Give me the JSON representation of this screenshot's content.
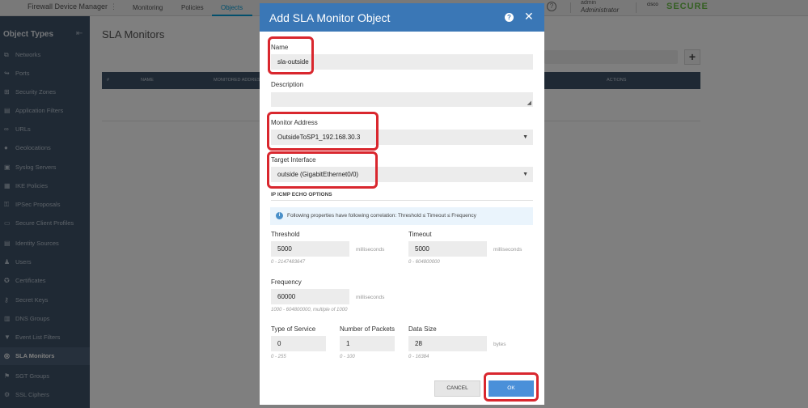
{
  "header": {
    "app_title": "Firewall Device Manager",
    "nav": [
      "Monitoring",
      "Policies",
      "Objects"
    ],
    "active_nav": "Objects",
    "user_name": "admin",
    "user_role": "Administrator",
    "brand_cisco": "cisco",
    "brand_secure": "SECURE"
  },
  "sidebar": {
    "title": "Object Types",
    "items": [
      {
        "label": "Networks",
        "icon": "network-icon"
      },
      {
        "label": "Ports",
        "icon": "ports-icon"
      },
      {
        "label": "Security Zones",
        "icon": "zones-icon"
      },
      {
        "label": "Application Filters",
        "icon": "filter-icon"
      },
      {
        "label": "URLs",
        "icon": "link-icon"
      },
      {
        "label": "Geolocations",
        "icon": "location-icon"
      },
      {
        "label": "Syslog Servers",
        "icon": "server-icon"
      },
      {
        "label": "IKE Policies",
        "icon": "lock-icon"
      },
      {
        "label": "IPSec Proposals",
        "icon": "proposal-icon"
      },
      {
        "label": "Secure Client Profiles",
        "icon": "profile-icon"
      },
      {
        "label": "Identity Sources",
        "icon": "identity-icon"
      },
      {
        "label": "Users",
        "icon": "user-icon"
      },
      {
        "label": "Certificates",
        "icon": "certificate-icon"
      },
      {
        "label": "Secret Keys",
        "icon": "key-icon"
      },
      {
        "label": "DNS Groups",
        "icon": "dns-icon"
      },
      {
        "label": "Event List Filters",
        "icon": "event-filter-icon"
      },
      {
        "label": "SLA Monitors",
        "icon": "sla-icon"
      },
      {
        "label": "SGT Groups",
        "icon": "sgt-icon"
      },
      {
        "label": "SSL Ciphers",
        "icon": "cipher-icon"
      }
    ],
    "active_item": "SLA Monitors"
  },
  "main": {
    "page_title": "SLA Monitors",
    "table_headers": [
      "#",
      "NAME",
      "MONITORED ADDRESS",
      "ACTIONS"
    ]
  },
  "dialog": {
    "title": "Add SLA Monitor Object",
    "name_label": "Name",
    "name_value": "sla-outside",
    "description_label": "Description",
    "description_value": "",
    "monitor_address_label": "Monitor Address",
    "monitor_address_value": "OutsideToSP1_192.168.30.3",
    "target_interface_label": "Target Interface",
    "target_interface_value": "outside (GigabitEthernet0/0)",
    "section_title": "IP ICMP ECHO OPTIONS",
    "info_text": "Following properties have following correlation: Threshold ≤ Timeout ≤ Frequency",
    "threshold_label": "Threshold",
    "threshold_value": "5000",
    "threshold_unit": "milliseconds",
    "threshold_hint": "0 - 2147483647",
    "timeout_label": "Timeout",
    "timeout_value": "5000",
    "timeout_unit": "milliseconds",
    "timeout_hint": "0 - 604800000",
    "frequency_label": "Frequency",
    "frequency_value": "60000",
    "frequency_unit": "milliseconds",
    "frequency_hint": "1000 - 604800000, multiple of 1000",
    "tos_label": "Type of Service",
    "tos_value": "0",
    "tos_hint": "0 - 255",
    "packets_label": "Number of Packets",
    "packets_value": "1",
    "packets_hint": "0 - 100",
    "datasize_label": "Data Size",
    "datasize_value": "28",
    "datasize_unit": "bytes",
    "datasize_hint": "0 - 16384",
    "cancel_label": "CANCEL",
    "ok_label": "OK"
  },
  "colors": {
    "dialog_header": "#3a77b6",
    "sidebar_bg": "#3f5269",
    "highlight": "#d9272e",
    "ok_button": "#4a90d9"
  }
}
